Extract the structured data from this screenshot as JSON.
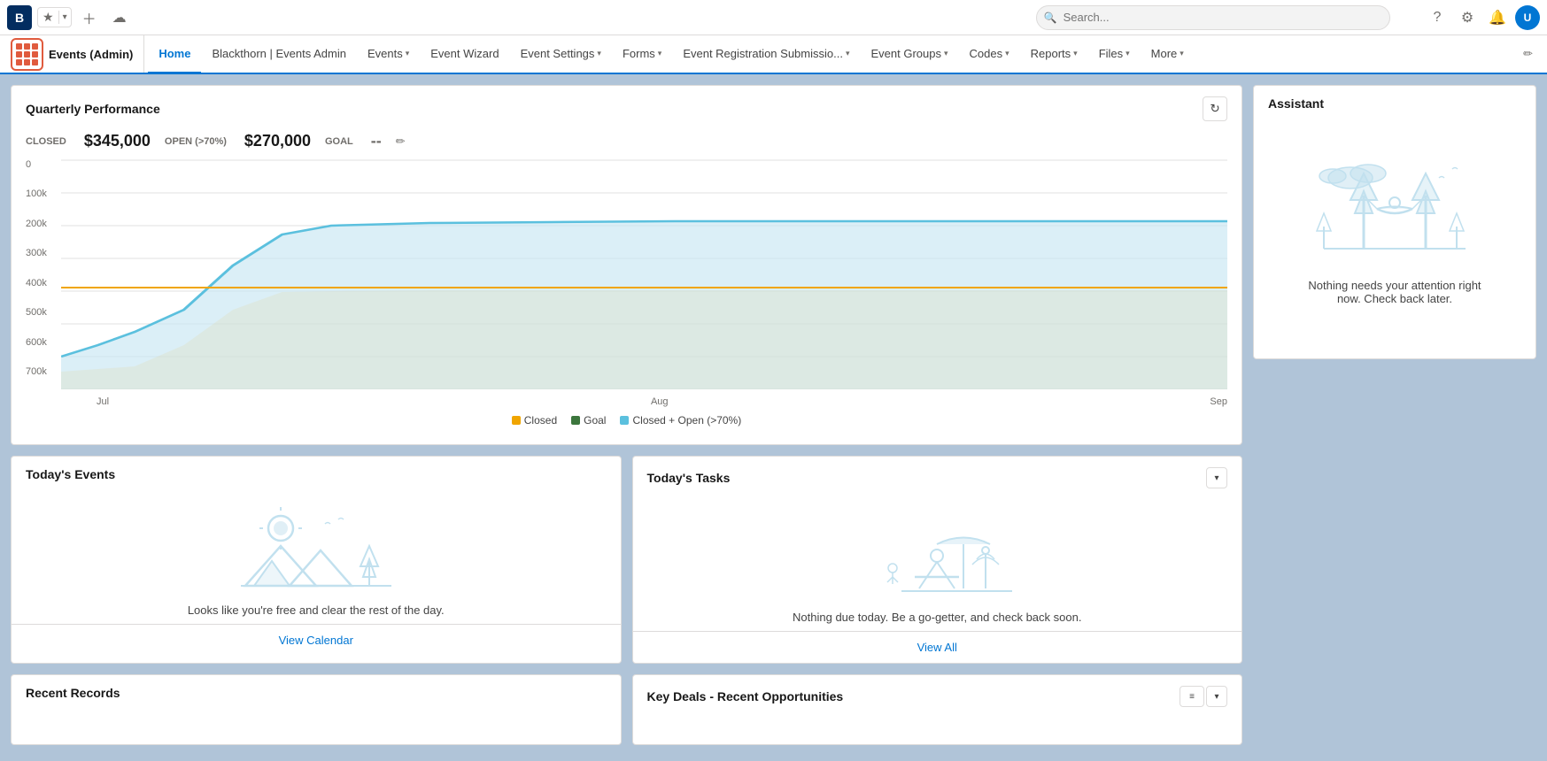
{
  "topbar": {
    "logo_letter": "B",
    "search_placeholder": "Search...",
    "icons": [
      "⭐",
      "▾",
      "+",
      "☁",
      "?",
      "⚙",
      "🔔"
    ],
    "avatar_text": "U"
  },
  "navbar": {
    "app_name": "Events (Admin)",
    "items": [
      {
        "label": "Home",
        "active": true,
        "has_dropdown": false
      },
      {
        "label": "Blackthorn | Events Admin",
        "active": false,
        "has_dropdown": false
      },
      {
        "label": "Events",
        "active": false,
        "has_dropdown": true
      },
      {
        "label": "Event Wizard",
        "active": false,
        "has_dropdown": false
      },
      {
        "label": "Event Settings",
        "active": false,
        "has_dropdown": true
      },
      {
        "label": "Forms",
        "active": false,
        "has_dropdown": true
      },
      {
        "label": "Event Registration Submissio...",
        "active": false,
        "has_dropdown": true
      },
      {
        "label": "Event Groups",
        "active": false,
        "has_dropdown": true
      },
      {
        "label": "Codes",
        "active": false,
        "has_dropdown": true
      },
      {
        "label": "Reports",
        "active": false,
        "has_dropdown": true
      },
      {
        "label": "Files",
        "active": false,
        "has_dropdown": true
      },
      {
        "label": "More",
        "active": false,
        "has_dropdown": true
      }
    ]
  },
  "quarterly": {
    "title": "Quarterly Performance",
    "closed_label": "CLOSED",
    "closed_value": "$345,000",
    "open_label": "OPEN (>70%)",
    "open_value": "$270,000",
    "goal_label": "GOAL",
    "goal_value": "--",
    "y_labels": [
      "0",
      "100k",
      "200k",
      "300k",
      "400k",
      "500k",
      "600k",
      "700k"
    ],
    "x_labels": [
      "Jul",
      "Aug",
      "Sep"
    ],
    "legend": [
      {
        "label": "Closed",
        "color": "#f0a500"
      },
      {
        "label": "Goal",
        "color": "#3c763d"
      },
      {
        "label": "Closed + Open (>70%)",
        "color": "#5bc0de"
      }
    ]
  },
  "todays_events": {
    "title": "Today's Events",
    "empty_text": "Looks like you're free and clear the rest of the day.",
    "view_link": "View Calendar"
  },
  "todays_tasks": {
    "title": "Today's Tasks",
    "empty_text": "Nothing due today. Be a go-getter, and check back soon.",
    "view_link": "View All"
  },
  "assistant": {
    "title": "Assistant",
    "empty_text": "Nothing needs your attention right now. Check back later."
  },
  "recent_records": {
    "title": "Recent Records"
  },
  "key_deals": {
    "title": "Key Deals - Recent Opportunities"
  }
}
